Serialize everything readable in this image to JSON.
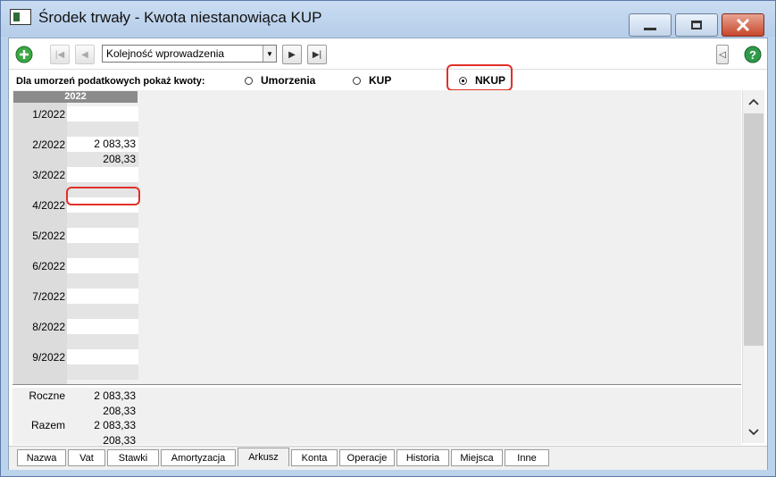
{
  "window": {
    "title": "Środek trwały - Kwota niestanowiąca KUP"
  },
  "toolbar": {
    "order_combo": "Kolejność wprowadzenia"
  },
  "filter": {
    "label": "Dla umorzeń podatkowych pokaż kwoty:",
    "options": [
      "Umorzenia",
      "KUP",
      "NKUP"
    ],
    "selected": "NKUP"
  },
  "grid": {
    "year": "2022",
    "rows": [
      {
        "month": "1/2022",
        "v1": "",
        "v2": ""
      },
      {
        "month": "2/2022",
        "v1": "2 083,33",
        "v2": "208,33"
      },
      {
        "month": "3/2022",
        "v1": "",
        "v2": ""
      },
      {
        "month": "4/2022",
        "v1": "",
        "v2": ""
      },
      {
        "month": "5/2022",
        "v1": "",
        "v2": ""
      },
      {
        "month": "6/2022",
        "v1": "",
        "v2": ""
      },
      {
        "month": "7/2022",
        "v1": "",
        "v2": ""
      },
      {
        "month": "8/2022",
        "v1": "",
        "v2": ""
      },
      {
        "month": "9/2022",
        "v1": "",
        "v2": ""
      }
    ]
  },
  "totals": {
    "roczne_label": "Roczne",
    "roczne_v1": "2 083,33",
    "roczne_v2": "208,33",
    "razem_label": "Razem",
    "razem_v1": "2 083,33",
    "razem_v2": "208,33"
  },
  "tabs": [
    "Nazwa",
    "Vat",
    "Stawki",
    "Amortyzacja",
    "Arkusz",
    "Konta",
    "Operacje",
    "Historia",
    "Miejsca",
    "Inne"
  ],
  "active_tab": "Arkusz",
  "colors": {
    "highlight": "#e0302a",
    "year_header": "#8b8b8b",
    "add_button": "#3aa844",
    "help_button": "#2f9b4a"
  }
}
